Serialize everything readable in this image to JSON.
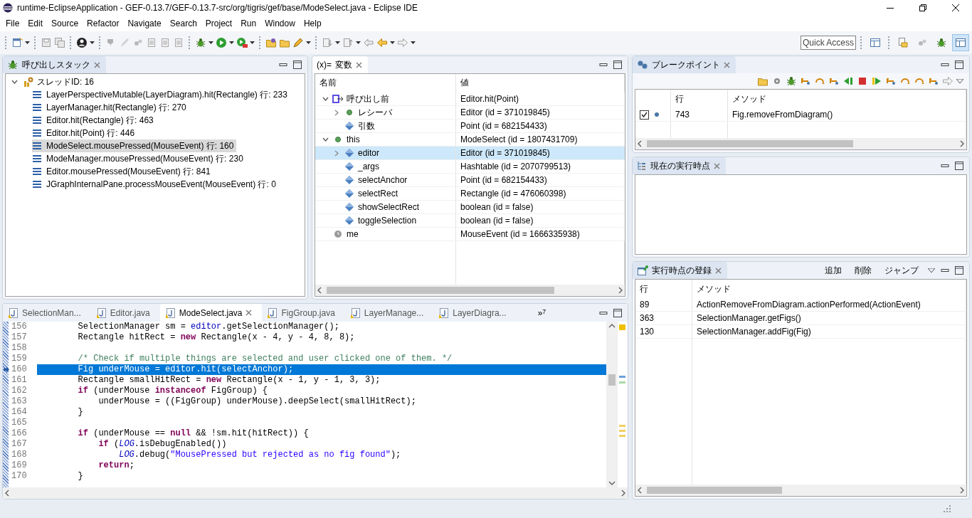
{
  "window": {
    "title": "runtime-EclipseApplication - GEF-0.13.7/GEF-0.13.7-src/org/tigris/gef/base/ModeSelect.java - Eclipse IDE"
  },
  "menu": [
    "File",
    "Edit",
    "Source",
    "Refactor",
    "Navigate",
    "Search",
    "Project",
    "Run",
    "Window",
    "Help"
  ],
  "toolbar": {
    "quick_access": {
      "placeholder": "Quick Access"
    },
    "perspectives": [
      {
        "kind": "open",
        "selected": false
      },
      {
        "kind": "resource",
        "selected": false
      },
      {
        "kind": "git",
        "selected": false
      },
      {
        "kind": "debug",
        "selected": false
      },
      {
        "kind": "layout",
        "selected": true
      }
    ]
  },
  "call_stack": {
    "title": "呼び出しスタック",
    "thread": {
      "label": "スレッドID: 16",
      "expanded": true
    },
    "frames": [
      {
        "label": "LayerPerspectiveMutable(LayerDiagram).hit(Rectangle) 行: 233",
        "selected": false
      },
      {
        "label": "LayerManager.hit(Rectangle) 行: 270",
        "selected": false
      },
      {
        "label": "Editor.hit(Rectangle) 行: 463",
        "selected": false
      },
      {
        "label": "Editor.hit(Point) 行: 446",
        "selected": false
      },
      {
        "label": "ModeSelect.mousePressed(MouseEvent) 行: 160",
        "selected": true
      },
      {
        "label": "ModeManager.mousePressed(MouseEvent) 行: 230",
        "selected": false
      },
      {
        "label": "Editor.mousePressed(MouseEvent) 行: 841",
        "selected": false
      },
      {
        "label": "JGraphInternalPane.processMouseEvent(MouseEvent) 行: 0",
        "selected": false
      }
    ]
  },
  "variables": {
    "icon_label": "(x)=",
    "title": "変数",
    "columns": [
      "名前",
      "値"
    ],
    "rows": [
      {
        "kind": "return",
        "name": "呼び出し前",
        "value": "Editor.hit(Point)",
        "expanded": true,
        "selected": false,
        "children": [
          {
            "kind": "object",
            "name": "レシーバ",
            "value": "Editor (id = 371019845)",
            "expanded": false,
            "selected": false
          },
          {
            "kind": "field",
            "name": "引数",
            "value": "Point (id = 682154433)",
            "selected": false
          }
        ]
      },
      {
        "kind": "object",
        "name": "this",
        "value": "ModeSelect (id = 1807431709)",
        "expanded": true,
        "selected": false,
        "children": [
          {
            "kind": "field",
            "name": "editor",
            "value": "Editor (id = 371019845)",
            "expanded": false,
            "selected": true
          },
          {
            "kind": "field",
            "name": "_args",
            "value": "Hashtable (id = 2070799513)",
            "selected": false
          },
          {
            "kind": "field",
            "name": "selectAnchor",
            "value": "Point (id = 682154433)",
            "selected": false
          },
          {
            "kind": "field",
            "name": "selectRect",
            "value": "Rectangle (id = 476060398)",
            "selected": false
          },
          {
            "kind": "field",
            "name": "showSelectRect",
            "value": "boolean (id = false)",
            "selected": false
          },
          {
            "kind": "field",
            "name": "toggleSelection",
            "value": "boolean (id = false)",
            "selected": false
          }
        ]
      },
      {
        "kind": "local",
        "name": "me",
        "value": "MouseEvent (id = 1666335938)",
        "selected": false
      }
    ]
  },
  "breakpoints": {
    "title": "ブレークポイント",
    "columns": [
      "行",
      "メソッド"
    ],
    "rows": [
      {
        "checked": true,
        "line": "743",
        "method": "Fig.removeFromDiagram()"
      }
    ]
  },
  "current_point": {
    "title": "現在の実行時点"
  },
  "registration": {
    "title": "実行時点の登録",
    "actions": [
      "追加",
      "削除",
      "ジャンプ"
    ],
    "columns": [
      "行",
      "メソッド"
    ],
    "rows": [
      {
        "line": "89",
        "method": "ActionRemoveFromDiagram.actionPerformed(ActionEvent)"
      },
      {
        "line": "363",
        "method": "SelectionManager.getFigs()"
      },
      {
        "line": "130",
        "method": "SelectionManager.addFig(Fig)"
      }
    ]
  },
  "editor": {
    "tabs": [
      {
        "label": "SelectionMan...",
        "selected": false
      },
      {
        "label": "Editor.java",
        "selected": false
      },
      {
        "label": "ModeSelect.java",
        "selected": true
      },
      {
        "label": "FigGroup.java",
        "selected": false
      },
      {
        "label": "LayerManage...",
        "selected": false
      },
      {
        "label": "LayerDiagra...",
        "selected": false
      }
    ],
    "overflow": "»",
    "overflow_count": "7",
    "lines": [
      {
        "number": "156",
        "current": false,
        "segments": [
          {
            "text": "        SelectionManager sm = ",
            "kind": "plain"
          },
          {
            "text": "editor",
            "kind": "field"
          },
          {
            "text": ".getSelectionManager();",
            "kind": "plain"
          }
        ]
      },
      {
        "number": "157",
        "current": false,
        "segments": [
          {
            "text": "        Rectangle hitRect = ",
            "kind": "plain"
          },
          {
            "text": "new",
            "kind": "keyword"
          },
          {
            "text": " Rectangle(x - 4, y - 4, 8, 8);",
            "kind": "plain"
          }
        ]
      },
      {
        "number": "158",
        "current": false
      },
      {
        "number": "159",
        "current": false,
        "segments": [
          {
            "text": "        /* Check if multiple things are selected and user clicked one of them. */",
            "kind": "comment"
          }
        ]
      },
      {
        "number": "160",
        "current": true,
        "segments": [
          {
            "text": "        Fig underMouse = ",
            "kind": "plain"
          },
          {
            "text": "editor",
            "kind": "field"
          },
          {
            "text": ".hit(",
            "kind": "plain"
          },
          {
            "text": "selectAnchor",
            "kind": "field"
          },
          {
            "text": ");",
            "kind": "plain"
          }
        ]
      },
      {
        "number": "161",
        "current": false,
        "segments": [
          {
            "text": "        Rectangle smallHitRect = ",
            "kind": "plain"
          },
          {
            "text": "new",
            "kind": "keyword"
          },
          {
            "text": " Rectangle(x - 1, y - 1, 3, 3);",
            "kind": "plain"
          }
        ]
      },
      {
        "number": "162",
        "current": false,
        "segments": [
          {
            "text": "        if",
            "kind": "keyword"
          },
          {
            "text": " (underMouse ",
            "kind": "plain"
          },
          {
            "text": "instanceof",
            "kind": "keyword"
          },
          {
            "text": " FigGroup) {",
            "kind": "plain"
          }
        ]
      },
      {
        "number": "163",
        "current": false,
        "segments": [
          {
            "text": "            underMouse = ((FigGroup) underMouse).deepSelect(smallHitRect);",
            "kind": "plain"
          }
        ]
      },
      {
        "number": "164",
        "current": false,
        "segments": [
          {
            "text": "        }",
            "kind": "plain"
          }
        ]
      },
      {
        "number": "165",
        "current": false
      },
      {
        "number": "166",
        "current": false,
        "segments": [
          {
            "text": "        if",
            "kind": "keyword"
          },
          {
            "text": " (underMouse == ",
            "kind": "plain"
          },
          {
            "text": "null",
            "kind": "keyword"
          },
          {
            "text": " && !sm.hit(hitRect)) {",
            "kind": "plain"
          }
        ]
      },
      {
        "number": "167",
        "current": false,
        "segments": [
          {
            "text": "            if",
            "kind": "keyword"
          },
          {
            "text": " (",
            "kind": "plain"
          },
          {
            "text": "LOG",
            "kind": "static"
          },
          {
            "text": ".isDebugEnabled())",
            "kind": "plain"
          }
        ]
      },
      {
        "number": "168",
        "current": false,
        "segments": [
          {
            "text": "                LOG",
            "kind": "static"
          },
          {
            "text": ".debug(",
            "kind": "plain"
          },
          {
            "text": "\"MousePressed but rejected as no fig found\"",
            "kind": "string"
          },
          {
            "text": ");",
            "kind": "plain"
          }
        ]
      },
      {
        "number": "169",
        "current": false,
        "segments": [
          {
            "text": "            return",
            "kind": "keyword"
          },
          {
            "text": ";",
            "kind": "plain"
          }
        ]
      },
      {
        "number": "170",
        "current": false,
        "segments": [
          {
            "text": "        }",
            "kind": "plain"
          }
        ]
      }
    ]
  }
}
